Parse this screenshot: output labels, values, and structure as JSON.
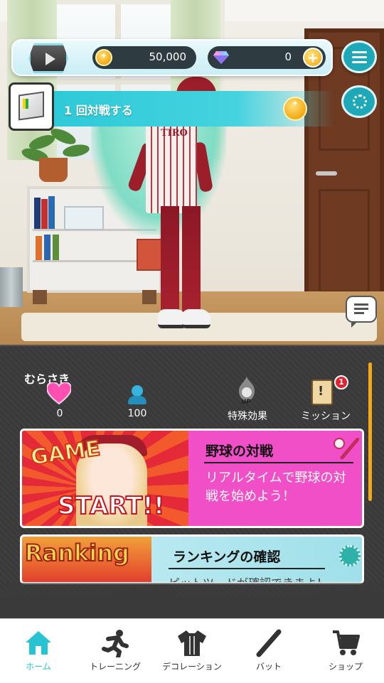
{
  "hud": {
    "coins": "50,000",
    "gems": "0"
  },
  "mission_banner": {
    "text": "1 回対戦する"
  },
  "profile": {
    "username": "むらさき",
    "hearts": "0",
    "followers": "100",
    "special_effect_label": "特殊効果",
    "mission_label": "ミッション",
    "mission_badge_count": "1"
  },
  "cards": {
    "game": {
      "art_text_top": "GAME",
      "art_text_bottom": "START!!",
      "title": "野球の対戦",
      "description": "リアルタイムで野球の対戦を始めよう！"
    },
    "ranking": {
      "art_text": "Ranking",
      "title": "ランキングの確認",
      "subtitle": "ピットツードが確認できまよ！"
    }
  },
  "scene": {
    "uniform_text": "TIRO"
  },
  "nav": {
    "items": [
      {
        "label": "ホーム",
        "icon": "home-icon",
        "active": true
      },
      {
        "label": "トレーニング",
        "icon": "running-icon",
        "active": false
      },
      {
        "label": "デコレーション",
        "icon": "jersey-icon",
        "active": false
      },
      {
        "label": "バット",
        "icon": "bat-icon",
        "active": false
      },
      {
        "label": "ショップ",
        "icon": "cart-icon",
        "active": false
      }
    ]
  },
  "colors": {
    "accent": "#26c3d2",
    "game_card": "#f04fc7",
    "badge_red": "#e5202f"
  }
}
